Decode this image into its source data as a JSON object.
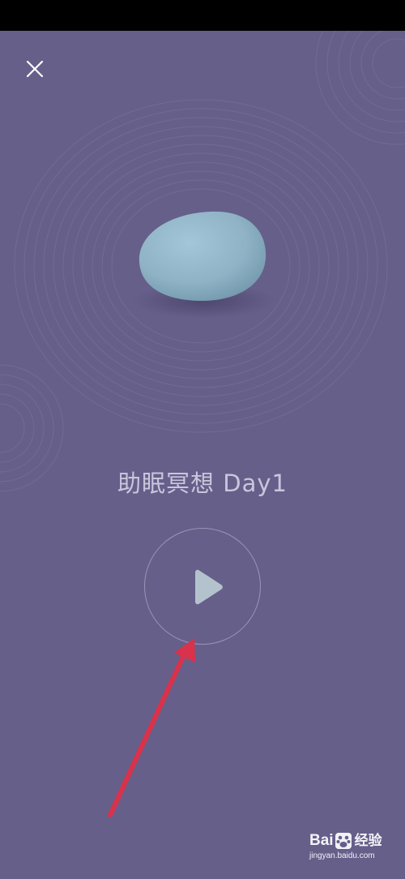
{
  "app": {
    "title": "助眠冥想 Day1"
  },
  "controls": {
    "close_icon": "close-icon",
    "play_icon": "play-icon"
  },
  "watermark": {
    "logo_left": "Bai",
    "logo_right": "经验",
    "url": "jingyan.baidu.com"
  },
  "colors": {
    "background": "#665f8a",
    "title_text": "#c9c6dc",
    "pebble": "#8fb3c5",
    "arrow": "#d9324a",
    "play_icon": "#b3c2cc"
  }
}
